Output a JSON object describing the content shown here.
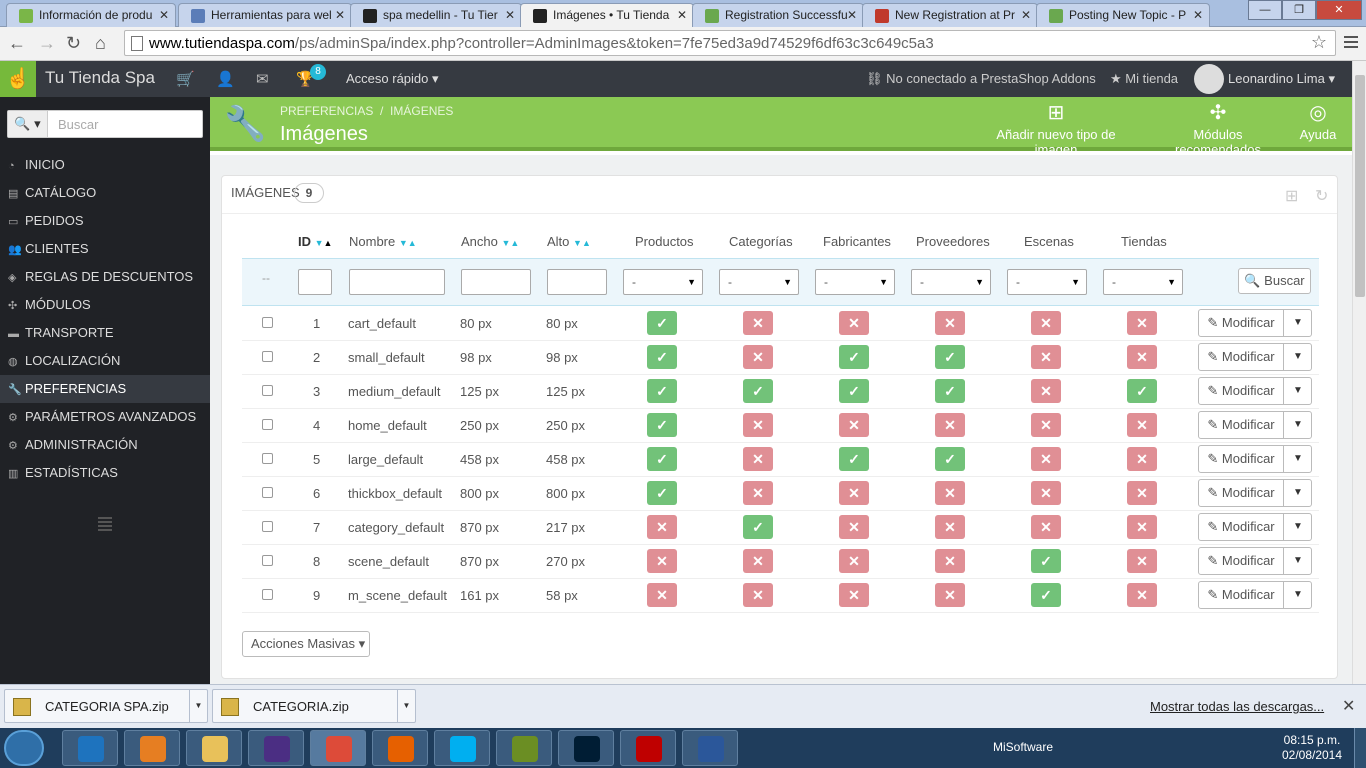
{
  "browser": {
    "tabs": [
      {
        "label": "Información de produ",
        "favicon_color": "#7ab648"
      },
      {
        "label": "Herramientas para wel",
        "favicon_color": "#5b7db8"
      },
      {
        "label": "spa medellin - Tu Tier",
        "favicon_color": "#222222"
      },
      {
        "label": "Imágenes • Tu Tienda",
        "favicon_color": "#222222",
        "active": true
      },
      {
        "label": "Registration Successfu",
        "favicon_color": "#6aa84f"
      },
      {
        "label": "New Registration at Pr",
        "favicon_color": "#c0392b"
      },
      {
        "label": "Posting New Topic - P",
        "favicon_color": "#6aa84f"
      }
    ],
    "url_domain": "www.tutiendaspa.com",
    "url_path": "/ps/adminSpa/index.php?controller=AdminImages&token=7fe75ed3a9d74529f6df63c3c649c5a3"
  },
  "header": {
    "shop_name": "Tu Tienda Spa",
    "notification_count": "8",
    "quick_access": "Acceso rápido",
    "addons_status": "No conectado a PrestaShop Addons",
    "my_shop": "Mi tienda",
    "user_name": "Leonardino Lima"
  },
  "sidebar": {
    "search_placeholder": "Buscar",
    "items": [
      {
        "label": "INICIO"
      },
      {
        "label": "CATÁLOGO"
      },
      {
        "label": "PEDIDOS"
      },
      {
        "label": "CLIENTES"
      },
      {
        "label": "REGLAS DE DESCUENTOS"
      },
      {
        "label": "MÓDULOS"
      },
      {
        "label": "TRANSPORTE"
      },
      {
        "label": "LOCALIZACIÓN"
      },
      {
        "label": "PREFERENCIAS",
        "selected": true
      },
      {
        "label": "PARÁMETROS AVANZADOS"
      },
      {
        "label": "ADMINISTRACIÓN"
      },
      {
        "label": "ESTADÍSTICAS"
      }
    ]
  },
  "toolbar": {
    "breadcrumb_parent": "PREFERENCIAS",
    "breadcrumb_sep": "/",
    "breadcrumb_current": "IMÁGENES",
    "title": "Imágenes",
    "add_label": "Añadir nuevo tipo de imagen",
    "modules_label": "Módulos recomendados",
    "help_label": "Ayuda"
  },
  "panel": {
    "heading": "IMÁGENES",
    "count": "9",
    "columns": {
      "id": "ID",
      "name": "Nombre",
      "width": "Ancho",
      "height": "Alto",
      "products": "Productos",
      "categories": "Categorías",
      "manufacturers": "Fabricantes",
      "suppliers": "Proveedores",
      "scenes": "Escenas",
      "stores": "Tiendas"
    },
    "filter_dash": "--",
    "filter_select_value": "-",
    "search_button": "Buscar",
    "modify_label": "Modificar",
    "bulk_actions": "Acciones Masivas",
    "rows": [
      {
        "id": "1",
        "name": "cart_default",
        "width": "80 px",
        "height": "80 px",
        "flags": [
          true,
          false,
          false,
          false,
          false,
          false
        ]
      },
      {
        "id": "2",
        "name": "small_default",
        "width": "98 px",
        "height": "98 px",
        "flags": [
          true,
          false,
          true,
          true,
          false,
          false
        ]
      },
      {
        "id": "3",
        "name": "medium_default",
        "width": "125 px",
        "height": "125 px",
        "flags": [
          true,
          true,
          true,
          true,
          false,
          true
        ]
      },
      {
        "id": "4",
        "name": "home_default",
        "width": "250 px",
        "height": "250 px",
        "flags": [
          true,
          false,
          false,
          false,
          false,
          false
        ]
      },
      {
        "id": "5",
        "name": "large_default",
        "width": "458 px",
        "height": "458 px",
        "flags": [
          true,
          false,
          true,
          true,
          false,
          false
        ]
      },
      {
        "id": "6",
        "name": "thickbox_default",
        "width": "800 px",
        "height": "800 px",
        "flags": [
          true,
          false,
          false,
          false,
          false,
          false
        ]
      },
      {
        "id": "7",
        "name": "category_default",
        "width": "870 px",
        "height": "217 px",
        "flags": [
          false,
          true,
          false,
          false,
          false,
          false
        ]
      },
      {
        "id": "8",
        "name": "scene_default",
        "width": "870 px",
        "height": "270 px",
        "flags": [
          false,
          false,
          false,
          false,
          true,
          false
        ]
      },
      {
        "id": "9",
        "name": "m_scene_default",
        "width": "161 px",
        "height": "58 px",
        "flags": [
          false,
          false,
          false,
          false,
          true,
          false
        ]
      }
    ]
  },
  "downloads": {
    "items": [
      "CATEGORIA SPA.zip",
      "CATEGORIA.zip"
    ],
    "show_all": "Mostrar todas las descargas..."
  },
  "taskbar": {
    "tray_label": "MiSoftware",
    "time": "08:15 p.m.",
    "date": "02/08/2014",
    "apps": [
      {
        "name": "internet-explorer",
        "color": "#1e73be"
      },
      {
        "name": "media-player",
        "color": "#e67e22"
      },
      {
        "name": "file-explorer",
        "color": "#e8c15a"
      },
      {
        "name": "eclipse",
        "color": "#4b2e83"
      },
      {
        "name": "chrome",
        "color": "#dd4b39",
        "active": true
      },
      {
        "name": "firefox",
        "color": "#e66000"
      },
      {
        "name": "skype",
        "color": "#00aff0"
      },
      {
        "name": "notepad-plus",
        "color": "#6b8e23"
      },
      {
        "name": "photoshop",
        "color": "#001d34"
      },
      {
        "name": "filezilla",
        "color": "#bf0000"
      },
      {
        "name": "word",
        "color": "#2b579a"
      }
    ]
  }
}
